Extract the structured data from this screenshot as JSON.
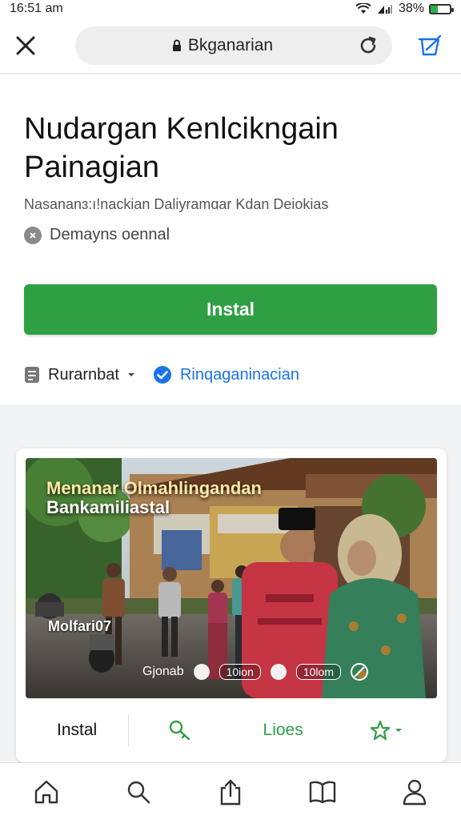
{
  "status": {
    "time": "16:51 am",
    "battery": "38%",
    "battery_level": 0.38
  },
  "browser": {
    "url": "Bkganarian"
  },
  "app": {
    "title": "Nudargan Kenlcikngain Painagian",
    "subtitle": "Nasananɜ:ı!nackian Daliyramɑar Kdan Deiokias",
    "rating_text": "Demayns oennal",
    "install_label": "Instal",
    "developer": "Rurarnbat",
    "verified_label": "Rinqaganinacian"
  },
  "feature": {
    "banner_line1": "Menanar Olmahlingandan",
    "banner_line2": "Bankamiliastal",
    "shop_sign": "Molfari07",
    "control_label": "Gjonab",
    "chip1": "10ion",
    "chip2": "10lom",
    "actions": {
      "install": "Instal",
      "like": "Lioes"
    }
  },
  "icons": [
    "close-icon",
    "lock-icon",
    "reload-icon",
    "share-icon",
    "verified-icon",
    "key-icon",
    "star-icon",
    "home-icon",
    "search-icon",
    "upload-icon",
    "book-icon",
    "person-icon"
  ],
  "colors": {
    "accent_green": "#2ea043",
    "link_blue": "#1a73e8"
  }
}
